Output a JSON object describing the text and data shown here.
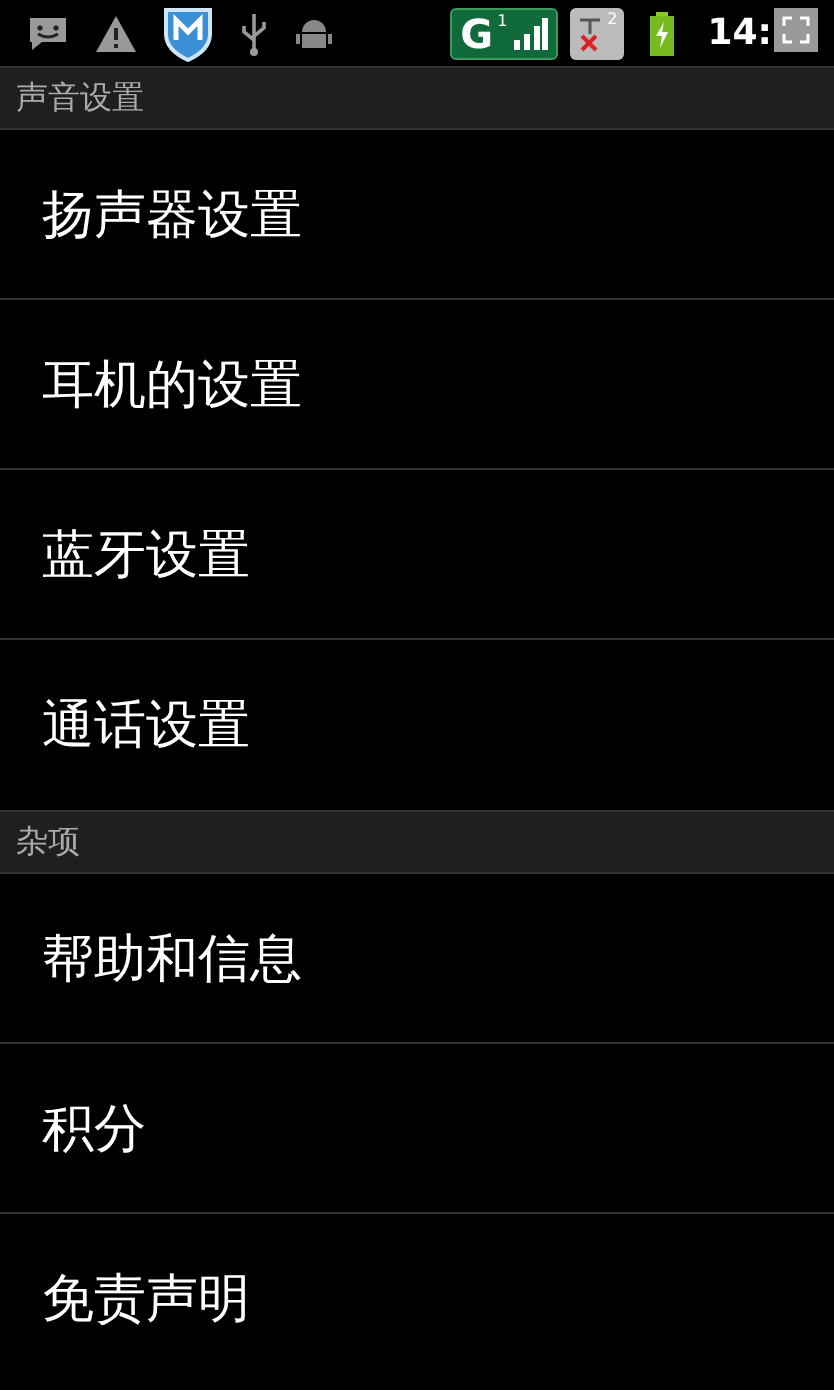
{
  "status_bar": {
    "sim1": {
      "network": "G",
      "slot": "1"
    },
    "sim2": {
      "slot": "2"
    },
    "time": "14:"
  },
  "sections": [
    {
      "title": "声音设置",
      "items": [
        {
          "label": "扬声器设置"
        },
        {
          "label": "耳机的设置"
        },
        {
          "label": "蓝牙设置"
        },
        {
          "label": "通话设置"
        }
      ]
    },
    {
      "title": "杂项",
      "items": [
        {
          "label": "帮助和信息"
        },
        {
          "label": "积分"
        },
        {
          "label": "免责声明"
        }
      ]
    }
  ]
}
